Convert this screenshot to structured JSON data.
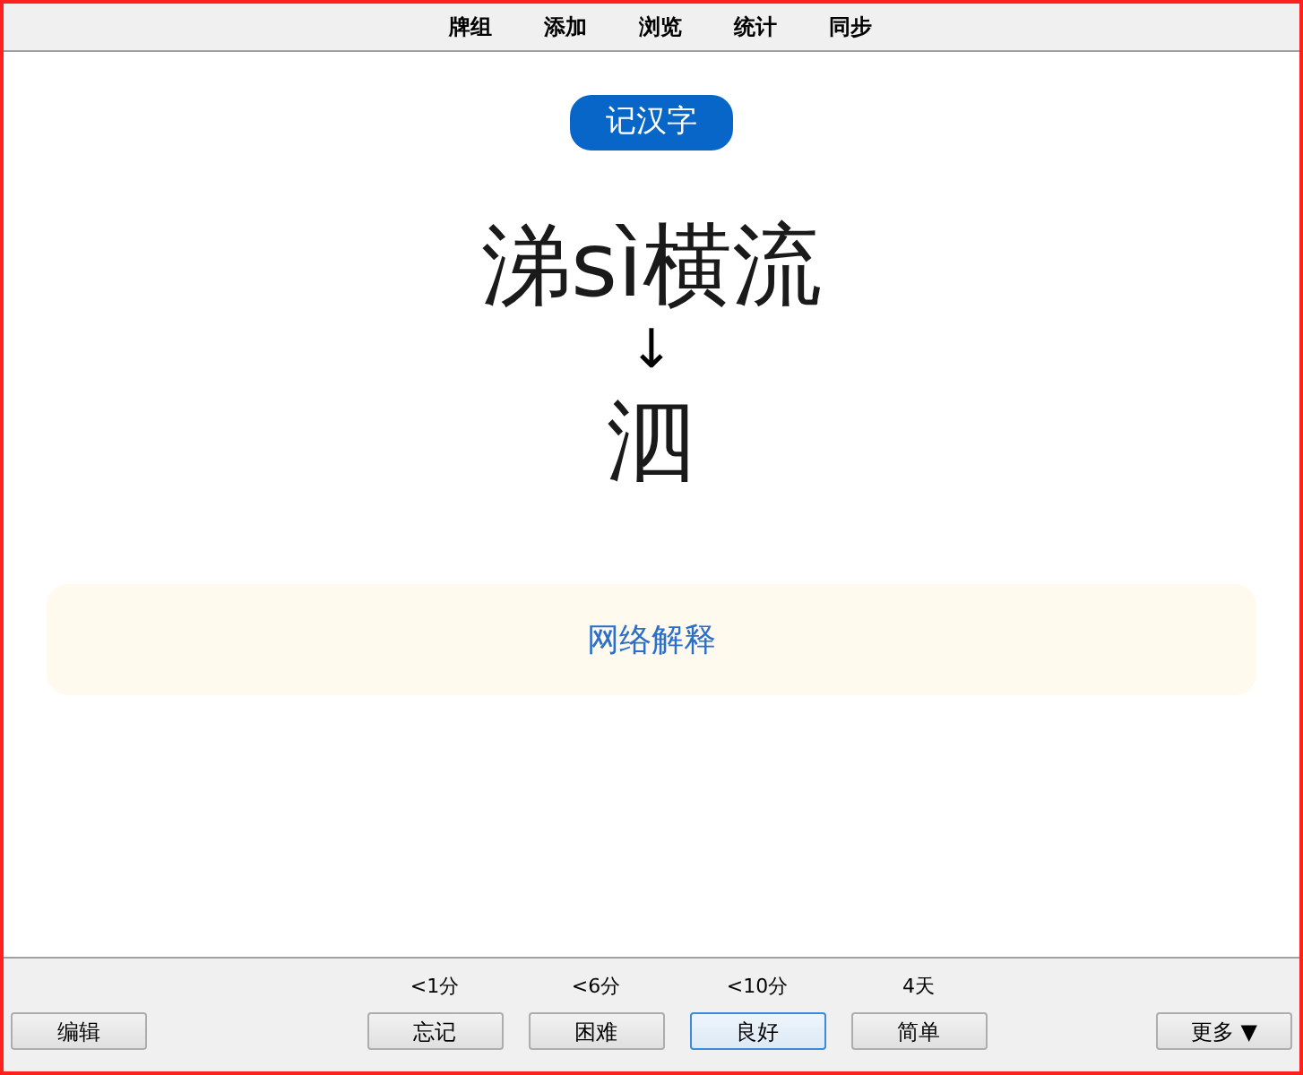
{
  "menu": [
    {
      "label": "牌组"
    },
    {
      "label": "添加"
    },
    {
      "label": "浏览"
    },
    {
      "label": "统计"
    },
    {
      "label": "同步"
    }
  ],
  "card": {
    "tag": "记汉字",
    "phrase": "涕sì横流",
    "arrow": "↓",
    "answer": "泗",
    "link": "网络解释"
  },
  "bottom_bar": {
    "edit_button": "编辑",
    "more_button": "更多 ▼",
    "answers": [
      {
        "interval": "<1分",
        "label": "忘记",
        "focused": false
      },
      {
        "interval": "<6分",
        "label": "困难",
        "focused": false
      },
      {
        "interval": "<10分",
        "label": "良好",
        "focused": true
      },
      {
        "interval": "4天",
        "label": "简单",
        "focused": false
      }
    ]
  }
}
